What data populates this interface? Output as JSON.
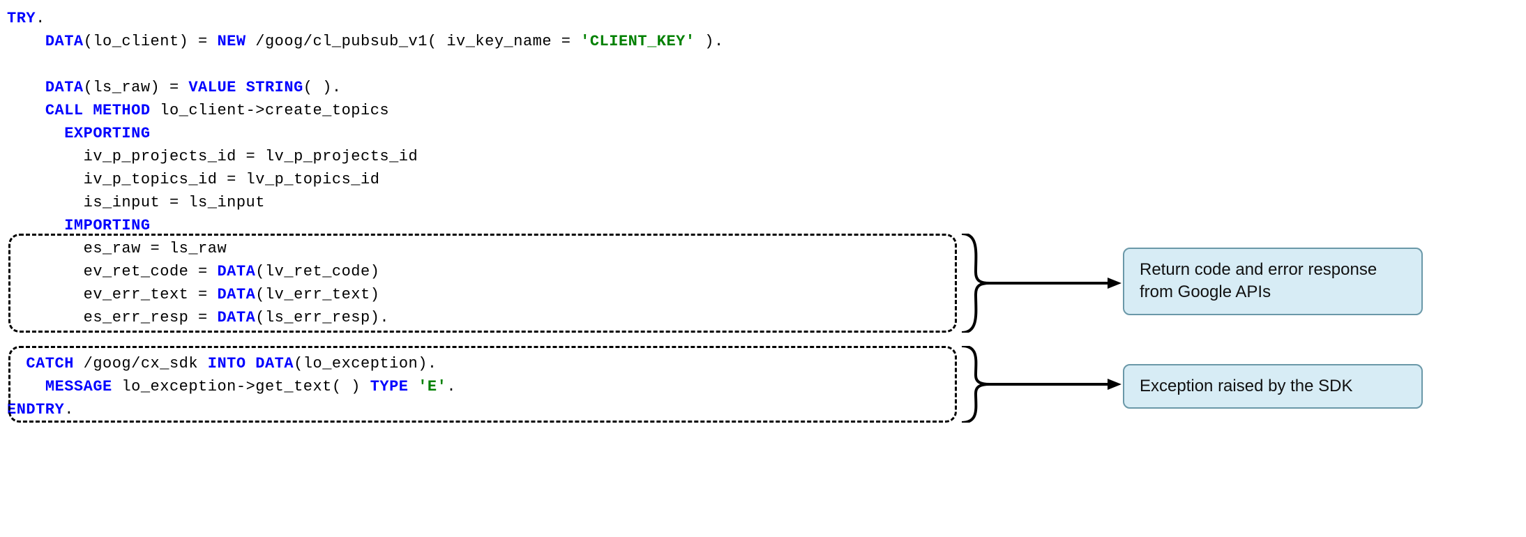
{
  "code": {
    "l1": {
      "a": "TRY",
      "b": "."
    },
    "l2": {
      "a": "DATA",
      "b": "(lo_client) = ",
      "c": "NEW ",
      "d": "/goog/cl_pubsub_v1( iv_key_name = ",
      "e": "'CLIENT_KEY' ",
      "f": ")."
    },
    "l3": "",
    "l4": {
      "a": "DATA",
      "b": "(ls_raw) = ",
      "c": "VALUE STRING",
      "d": "(  )."
    },
    "l5": {
      "a": "CALL METHOD ",
      "b": "lo_client->create_topics"
    },
    "l6": {
      "a": "EXPORTING"
    },
    "l7": {
      "a": "iv_p_projects_id = lv_p_projects_id"
    },
    "l8": {
      "a": "iv_p_topics_id   = lv_p_topics_id"
    },
    "l9": {
      "a": "is_input         = ls_input"
    },
    "l10": {
      "a": "IMPORTING"
    },
    "l11": {
      "a": "es_raw           = ls_raw"
    },
    "l12": {
      "a": "ev_ret_code      = ",
      "b": "DATA",
      "c": "(lv_ret_code)"
    },
    "l13": {
      "a": "ev_err_text      = ",
      "b": "DATA",
      "c": "(lv_err_text)"
    },
    "l14": {
      "a": "es_err_resp      = ",
      "b": "DATA",
      "c": "(ls_err_resp)."
    },
    "l15": "",
    "l16": {
      "a": "CATCH ",
      "b": "/goog/cx_sdk ",
      "c": "INTO DATA",
      "d": "(lo_exception)."
    },
    "l17": {
      "a": "MESSAGE ",
      "b": "lo_exception->get_text( ) ",
      "c": "TYPE ",
      "d": "'E'",
      "e": "."
    },
    "l18": {
      "a": "ENDTRY",
      "b": "."
    }
  },
  "callouts": {
    "top": "Return code and error response from Google APIs",
    "bottom": "Exception raised by the SDK"
  }
}
